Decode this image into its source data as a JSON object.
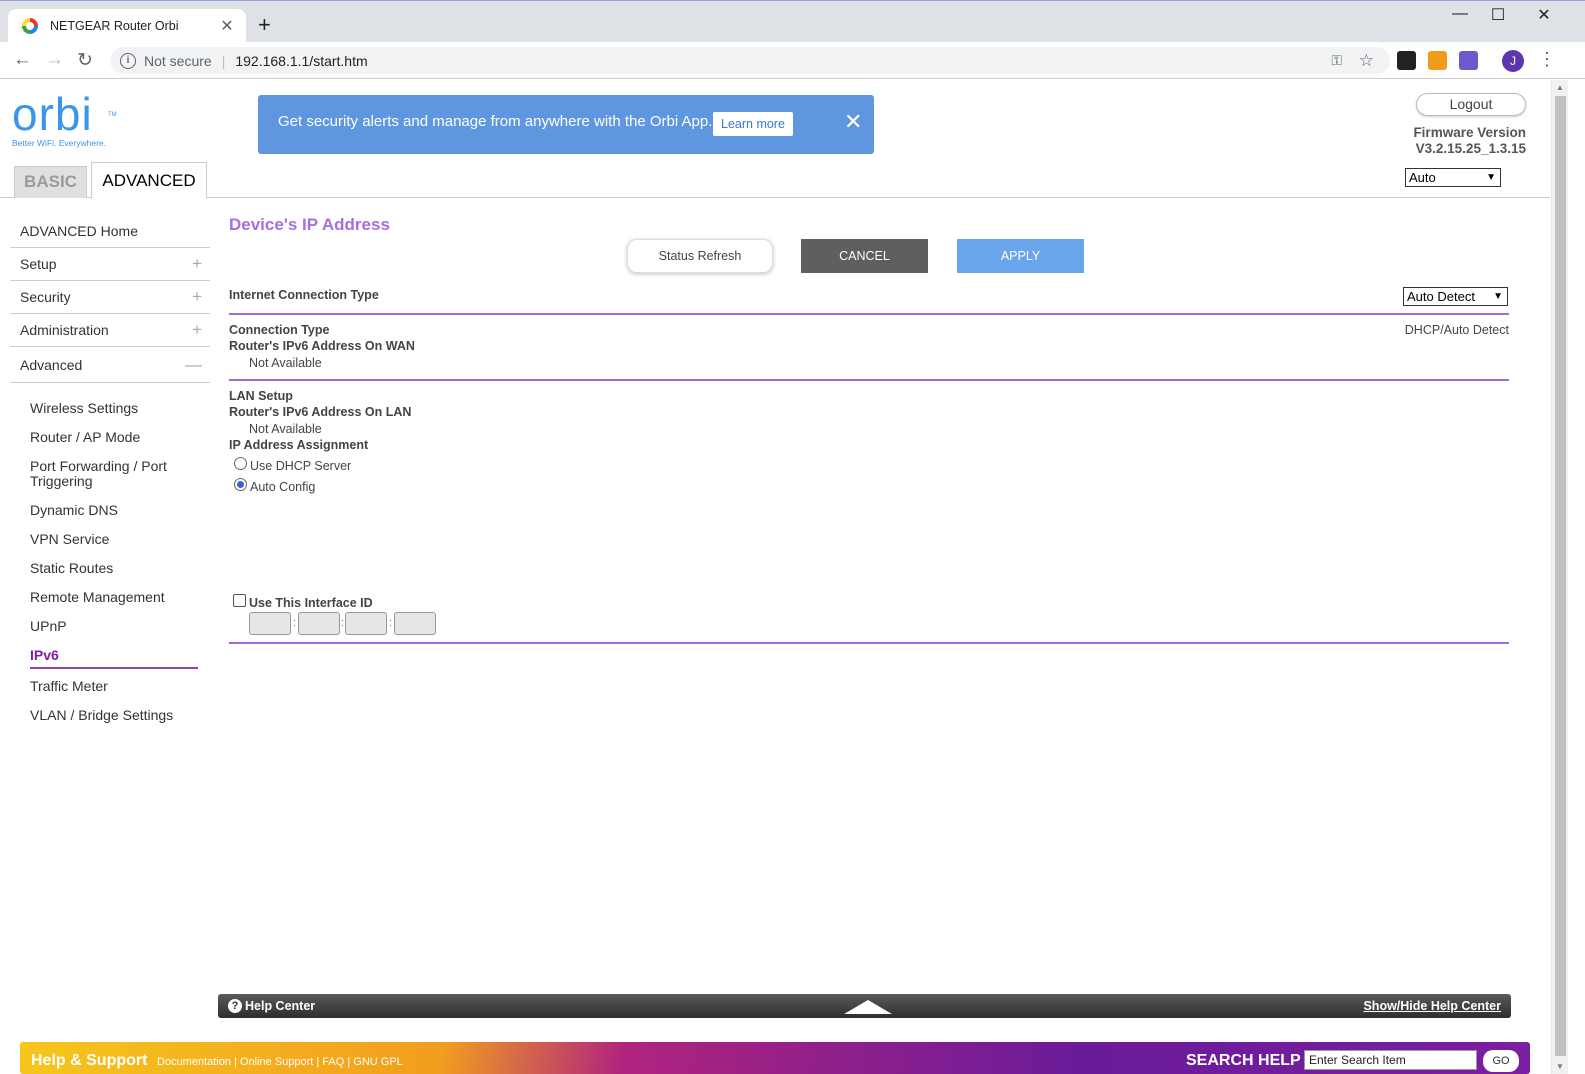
{
  "browser": {
    "tab_title": "NETGEAR Router Orbi",
    "security_label": "Not secure",
    "url": "192.168.1.1/start.htm"
  },
  "header": {
    "logo_text": "orbi",
    "logo_tm": "TM",
    "tagline": "Better WiFi. Everywhere.",
    "banner_text": "Get security alerts and manage from anywhere with the Orbi App.",
    "banner_button": "Learn more",
    "logout_label": "Logout",
    "firmware_label": "Firmware Version",
    "firmware_value": "V3.2.15.25_1.3.15",
    "language_value": "Auto",
    "tab_basic": "BASIC",
    "tab_advanced": "ADVANCED"
  },
  "sidebar": {
    "main": [
      {
        "label": "ADVANCED Home",
        "toggle": ""
      },
      {
        "label": "Setup",
        "toggle": "+"
      },
      {
        "label": "Security",
        "toggle": "+"
      },
      {
        "label": "Administration",
        "toggle": "+"
      },
      {
        "label": "Advanced",
        "toggle": "—"
      }
    ],
    "sub": [
      "Wireless Settings",
      "Router / AP Mode",
      "Port Forwarding / Port Triggering",
      "Dynamic DNS",
      "VPN Service",
      "Static Routes",
      "Remote Management",
      "UPnP",
      "IPv6",
      "Traffic Meter",
      "VLAN / Bridge Settings"
    ],
    "active_sub": "IPv6"
  },
  "content": {
    "title": "Device's IP Address",
    "btn_refresh": "Status Refresh",
    "btn_cancel": "CANCEL",
    "btn_apply": "APPLY",
    "internet_conn_type_label": "Internet Connection Type",
    "internet_conn_type_value": "Auto Detect",
    "connection_type_label": "Connection Type",
    "connection_type_value": "DHCP/Auto Detect",
    "wan_ipv6_label": "Router's IPv6 Address On WAN",
    "wan_ipv6_value": "Not Available",
    "lan_setup_label": "LAN Setup",
    "lan_ipv6_label": "Router's IPv6 Address On LAN",
    "lan_ipv6_value": "Not Available",
    "ip_assign_label": "IP Address Assignment",
    "opt_dhcp": "Use DHCP Server",
    "opt_auto": "Auto Config",
    "selected_assignment": "Auto Config",
    "interface_id_label": "Use This Interface ID",
    "interface_id_checked": false,
    "interface_id_sep": ":"
  },
  "help": {
    "help_center": "Help Center",
    "toggle": "Show/Hide Help Center",
    "footer_title": "Help & Support",
    "footer_links": "Documentation | Online Support | FAQ | GNU GPL",
    "search_label": "SEARCH HELP",
    "search_placeholder": "Enter Search Item",
    "go": "GO"
  },
  "colors": {
    "accent_purple": "#9b6cdb",
    "banner_blue": "#5e97e0",
    "apply_blue": "#6aa4ea",
    "cancel_gray": "#5f5f5f"
  }
}
